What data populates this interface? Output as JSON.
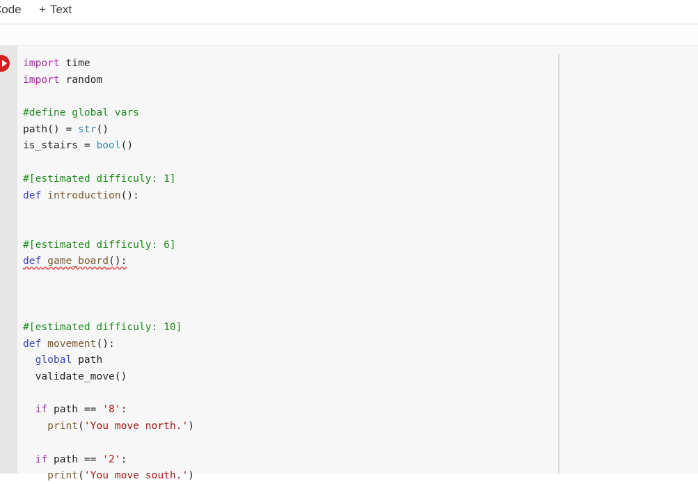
{
  "toolbar": {
    "code_label": "Code",
    "text_plus": "+",
    "text_label": "Text"
  },
  "cell": {
    "run_icon": "play-icon",
    "run_color": "#d61f1f",
    "lines": [
      {
        "indent": "",
        "tokens": [
          {
            "t": "import",
            "c": "kw"
          },
          {
            "t": " time",
            "c": ""
          }
        ]
      },
      {
        "indent": "",
        "tokens": [
          {
            "t": "import",
            "c": "kw"
          },
          {
            "t": " random",
            "c": ""
          }
        ]
      },
      {
        "indent": "",
        "tokens": []
      },
      {
        "indent": "",
        "tokens": [
          {
            "t": "#define global vars",
            "c": "cm"
          }
        ]
      },
      {
        "indent": "",
        "tokens": [
          {
            "t": "path() = ",
            "c": ""
          },
          {
            "t": "str",
            "c": "bi"
          },
          {
            "t": "()",
            "c": ""
          }
        ]
      },
      {
        "indent": "",
        "tokens": [
          {
            "t": "is_stairs = ",
            "c": ""
          },
          {
            "t": "bool",
            "c": "bi"
          },
          {
            "t": "()",
            "c": ""
          }
        ]
      },
      {
        "indent": "",
        "tokens": []
      },
      {
        "indent": "",
        "tokens": [
          {
            "t": "#[estimated difficuly: 1]",
            "c": "cm"
          }
        ]
      },
      {
        "indent": "",
        "tokens": [
          {
            "t": "def",
            "c": "kw2"
          },
          {
            "t": " ",
            "c": ""
          },
          {
            "t": "introduction",
            "c": "fn"
          },
          {
            "t": "():",
            "c": ""
          }
        ]
      },
      {
        "indent": "",
        "tokens": []
      },
      {
        "indent": "",
        "tokens": []
      },
      {
        "indent": "",
        "tokens": [
          {
            "t": "#[estimated difficuly: 6]",
            "c": "cm"
          }
        ]
      },
      {
        "indent": "",
        "tokens": [
          {
            "t": "def",
            "c": "kw2 squig"
          },
          {
            "t": " ",
            "c": "squig"
          },
          {
            "t": "game_board",
            "c": "fn squig"
          },
          {
            "t": "():",
            "c": "squig"
          }
        ]
      },
      {
        "indent": "",
        "tokens": []
      },
      {
        "indent": "",
        "tokens": []
      },
      {
        "indent": "",
        "tokens": []
      },
      {
        "indent": "",
        "tokens": [
          {
            "t": "#[estimated difficuly: 10]",
            "c": "cm"
          }
        ]
      },
      {
        "indent": "",
        "tokens": [
          {
            "t": "def",
            "c": "kw2"
          },
          {
            "t": " ",
            "c": ""
          },
          {
            "t": "movement",
            "c": "fn"
          },
          {
            "t": "():",
            "c": ""
          }
        ]
      },
      {
        "indent": "  ",
        "tokens": [
          {
            "t": "global",
            "c": "kw2"
          },
          {
            "t": " path",
            "c": ""
          }
        ]
      },
      {
        "indent": "  ",
        "tokens": [
          {
            "t": "validate_move()",
            "c": ""
          }
        ]
      },
      {
        "indent": "",
        "tokens": []
      },
      {
        "indent": "  ",
        "tokens": [
          {
            "t": "if",
            "c": "kw"
          },
          {
            "t": " path == ",
            "c": ""
          },
          {
            "t": "'8'",
            "c": "st"
          },
          {
            "t": ":",
            "c": ""
          }
        ]
      },
      {
        "indent": "    ",
        "tokens": [
          {
            "t": "print",
            "c": "fn"
          },
          {
            "t": "(",
            "c": ""
          },
          {
            "t": "'You move north.'",
            "c": "st"
          },
          {
            "t": ")",
            "c": ""
          }
        ]
      },
      {
        "indent": "",
        "tokens": []
      },
      {
        "indent": "  ",
        "tokens": [
          {
            "t": "if",
            "c": "kw"
          },
          {
            "t": " path == ",
            "c": ""
          },
          {
            "t": "'2'",
            "c": "st"
          },
          {
            "t": ":",
            "c": ""
          }
        ]
      },
      {
        "indent": "    ",
        "tokens": [
          {
            "t": "print",
            "c": "fn"
          },
          {
            "t": "(",
            "c": ""
          },
          {
            "t": "'You move south.'",
            "c": "st"
          },
          {
            "t": ")",
            "c": ""
          }
        ]
      }
    ]
  }
}
